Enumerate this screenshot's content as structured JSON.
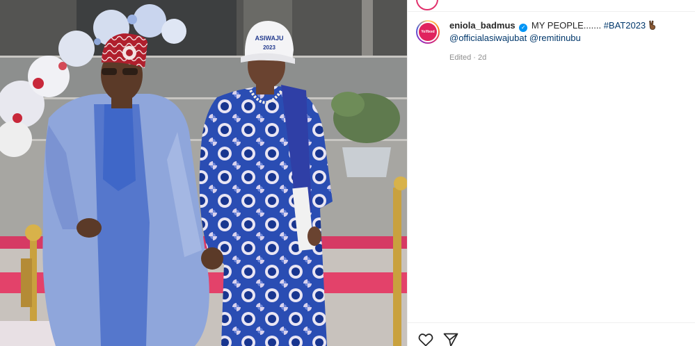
{
  "post": {
    "username": "eniola_badmus",
    "caption_text": "MY PEOPLE....... ",
    "hashtag": "#BAT2023",
    "mention_1": "@officialasiwajubat",
    "mention_2": "@remitinubu",
    "edited_label": "Edited",
    "separator": " · ",
    "time_ago": "2d",
    "avatar_text": "Yo!fixed"
  },
  "image": {
    "cap_line_1": "ASIWAJU",
    "cap_line_2": "2023",
    "icons": [
      "heart-icon",
      "share-icon",
      "verified-badge-icon",
      "victory-hand-icon"
    ]
  },
  "colors": {
    "link": "#00376b",
    "verified": "#0095f6",
    "muted": "#8e8e8e",
    "agbada": "#8fa6db",
    "ankara_blue": "#1d3f9e",
    "carpet": "#e3426a"
  }
}
